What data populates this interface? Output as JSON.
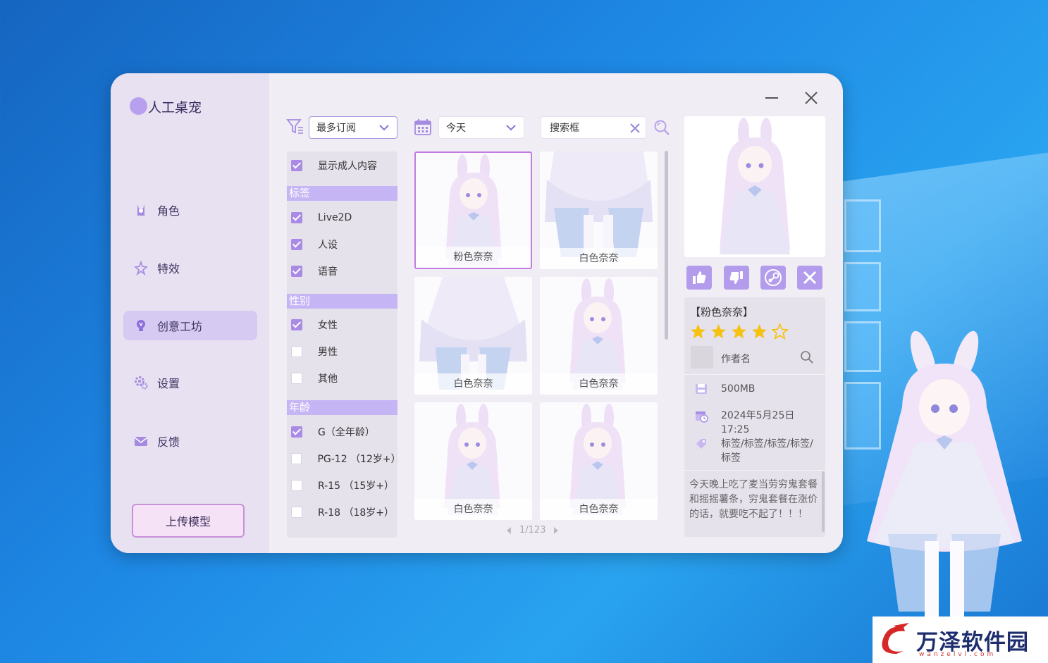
{
  "app": {
    "title": "人工桌宠"
  },
  "nav": {
    "items": [
      {
        "label": "角色",
        "icon": "character-icon"
      },
      {
        "label": "特效",
        "icon": "effects-icon"
      },
      {
        "label": "创意工坊",
        "icon": "lightbulb-icon",
        "active": true
      },
      {
        "label": "设置",
        "icon": "gear-icon"
      },
      {
        "label": "反馈",
        "icon": "mail-icon"
      }
    ],
    "upload_label": "上传模型"
  },
  "toolbar": {
    "sort_value": "最多订阅",
    "date_value": "今天",
    "search_placeholder": "搜索框"
  },
  "filters": {
    "adult": {
      "label": "显示成人内容",
      "checked": true
    },
    "tags_header": "标签",
    "tags": [
      {
        "label": "Live2D",
        "checked": true
      },
      {
        "label": "人设",
        "checked": true
      },
      {
        "label": "语音",
        "checked": true
      }
    ],
    "gender_header": "性别",
    "genders": [
      {
        "label": "女性",
        "checked": true
      },
      {
        "label": "男性",
        "checked": false
      },
      {
        "label": "其他",
        "checked": false
      }
    ],
    "age_header": "年龄",
    "ages": [
      {
        "label": "G（全年龄）",
        "checked": true
      },
      {
        "label": "PG-12 （12岁+）",
        "checked": false
      },
      {
        "label": "R-15 （15岁+）",
        "checked": false
      },
      {
        "label": "R-18 （18岁+）",
        "checked": false
      }
    ]
  },
  "grid": {
    "cards": [
      {
        "label": "粉色奈奈",
        "selected": true
      },
      {
        "label": "白色奈奈"
      },
      {
        "label": "白色奈奈"
      },
      {
        "label": "白色奈奈"
      },
      {
        "label": "白色奈奈"
      },
      {
        "label": "白色奈奈"
      }
    ],
    "pager": "1/123"
  },
  "detail": {
    "name": "【粉色奈奈】",
    "rating": 4,
    "rating_max": 5,
    "author": "作者名",
    "size": "500MB",
    "date": "2024年5月25日 17:25",
    "tags": "标签/标签/标签/标签/标签",
    "description": "今天晚上吃了麦当劳穷鬼套餐和摇摇薯条，穷鬼套餐在涨价的话，就要吃不起了！！！"
  },
  "watermark": {
    "title": "万泽软件园",
    "sub": "wanzelvl.com"
  },
  "colors": {
    "accent": "#b39ceb",
    "header": "#c6b5f4",
    "star": "#f5c211"
  }
}
